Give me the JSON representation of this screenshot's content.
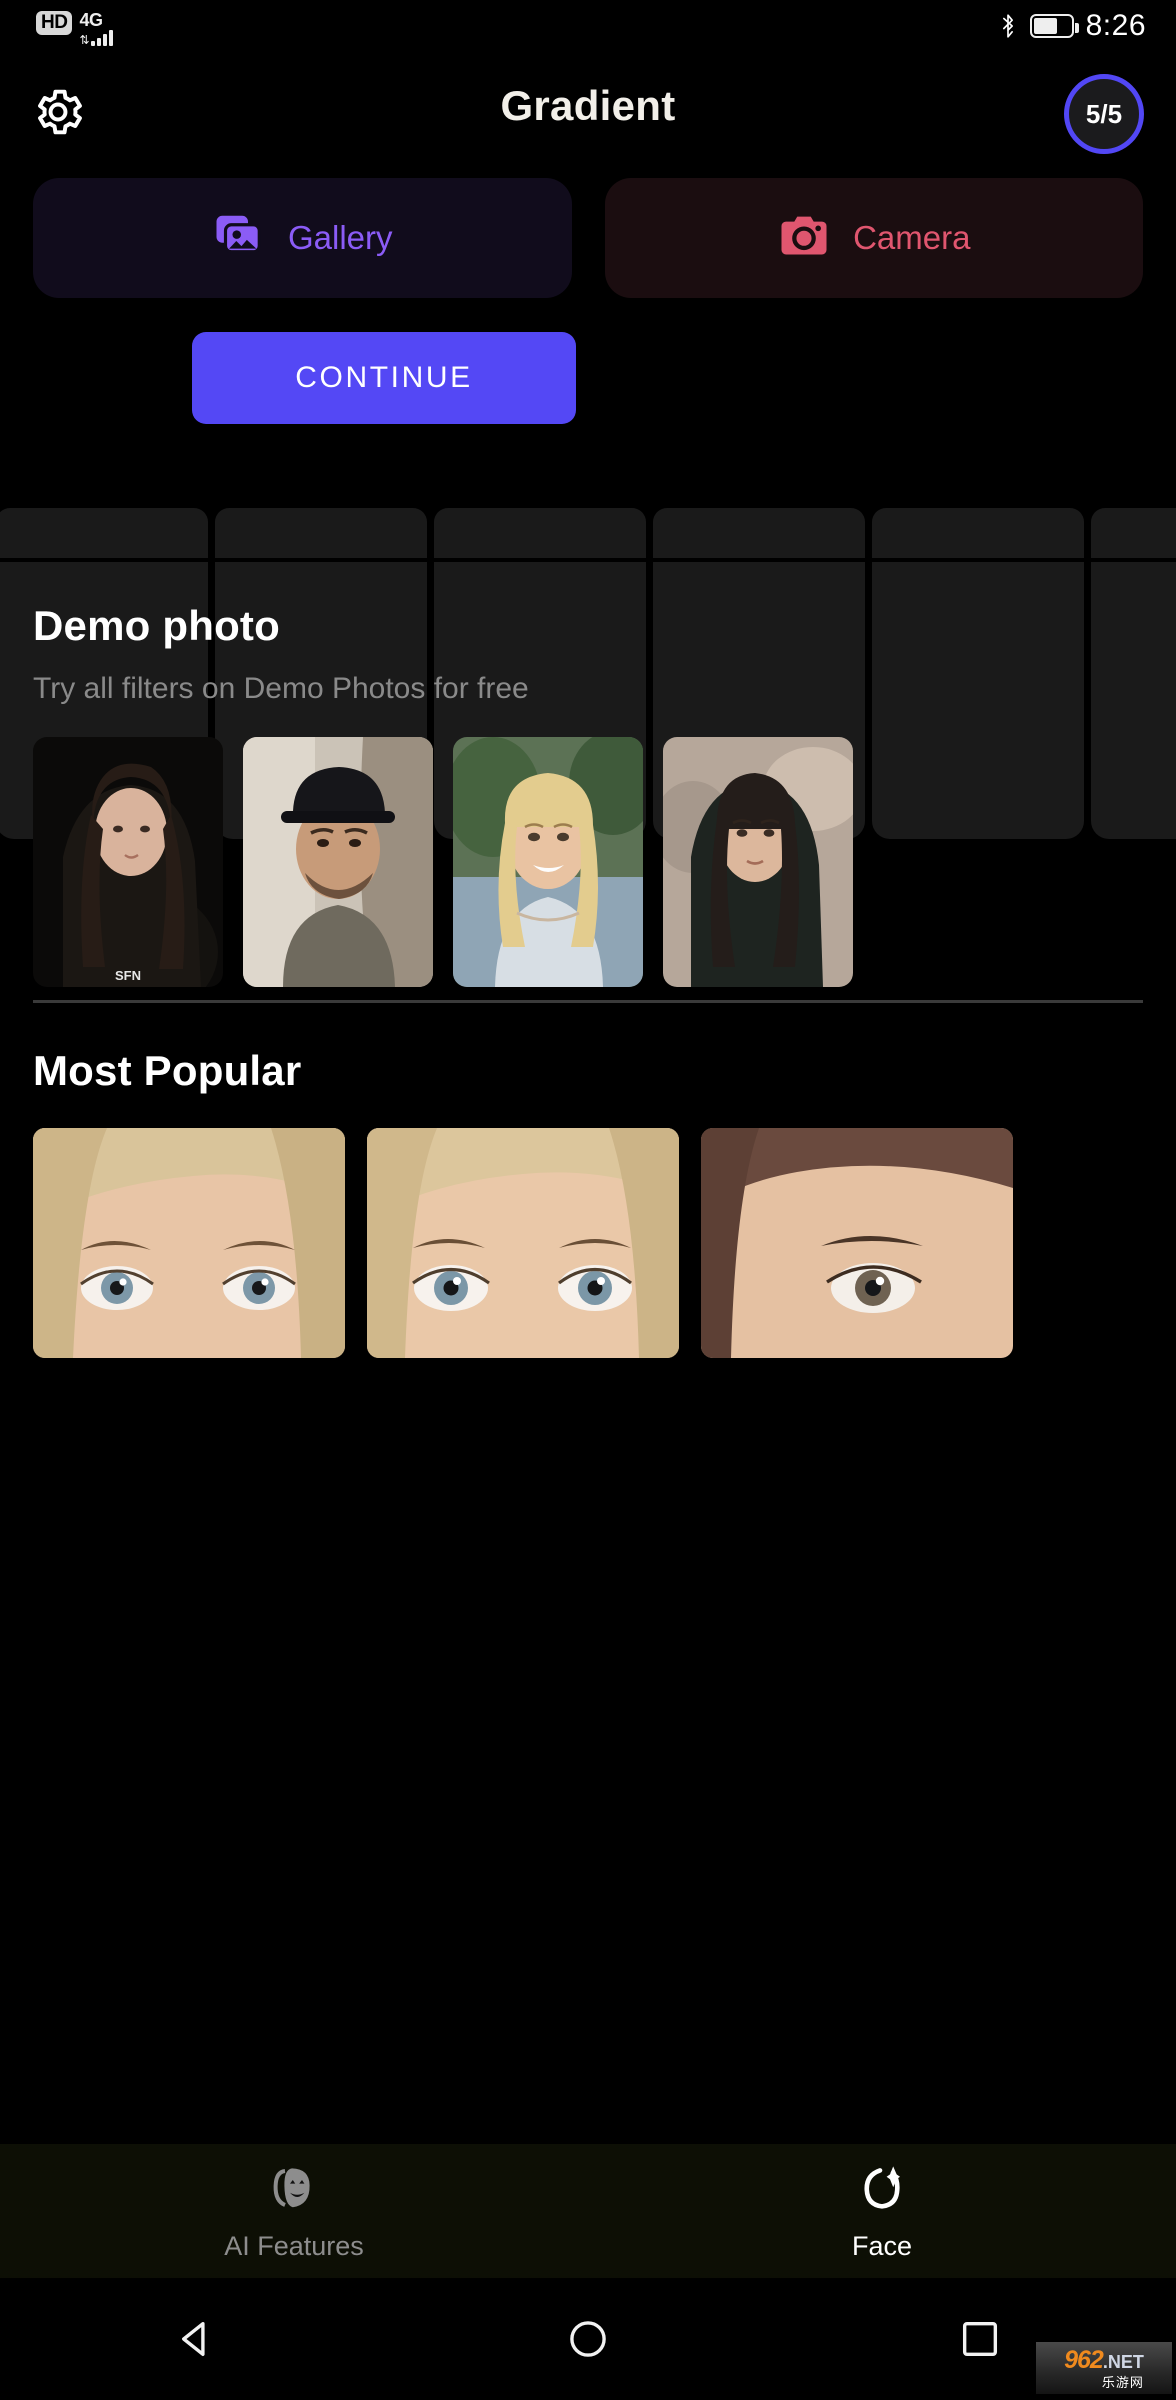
{
  "status_bar": {
    "hd_badge": "HD",
    "network_type": "4G",
    "signal_icon": "signal-bars-icon",
    "data_arrows_icon": "data-transfer-arrows-icon",
    "bluetooth_icon": "bluetooth-icon",
    "battery_icon": "battery-icon",
    "battery_level_percent": 58,
    "time": "8:26"
  },
  "header": {
    "settings_icon": "gear-icon",
    "title": "Gradient",
    "credits_badge": "5/5"
  },
  "source_buttons": [
    {
      "label": "Gallery",
      "icon": "gallery-icon",
      "color": "#8b5cf6",
      "bg": "#110c1c"
    },
    {
      "label": "Camera",
      "icon": "camera-icon",
      "color": "#e0566f",
      "bg": "#1b0d10"
    }
  ],
  "continue_button": {
    "label": "CONTINUE",
    "color": "#5448f5"
  },
  "thumbnail_placeholders": {
    "count": 5,
    "color": "#1a1a1a"
  },
  "demo_section": {
    "title": "Demo photo",
    "subtitle": "Try all filters on Demo Photos for free",
    "photos": [
      {
        "name": "demo-photo-brunette-woman",
        "caption": "SFN"
      },
      {
        "name": "demo-photo-man-cap"
      },
      {
        "name": "demo-photo-blonde-smiling"
      },
      {
        "name": "demo-photo-dark-hair-woman"
      }
    ]
  },
  "popular_section": {
    "title": "Most Popular",
    "photos": [
      {
        "name": "popular-photo-eyes-1"
      },
      {
        "name": "popular-photo-eyes-2"
      },
      {
        "name": "popular-photo-eyes-3"
      }
    ]
  },
  "bottom_nav": {
    "items": [
      {
        "label": "AI Features",
        "icon": "theater-masks-icon",
        "active": false
      },
      {
        "label": "Face",
        "icon": "face-sparkle-icon",
        "active": true
      }
    ]
  },
  "android_nav": {
    "back_icon": "back-triangle-icon",
    "home_icon": "home-circle-icon",
    "recents_icon": "recents-square-icon"
  },
  "watermark": {
    "primary": "962",
    "domain": ".NET",
    "chinese": "乐游网"
  }
}
